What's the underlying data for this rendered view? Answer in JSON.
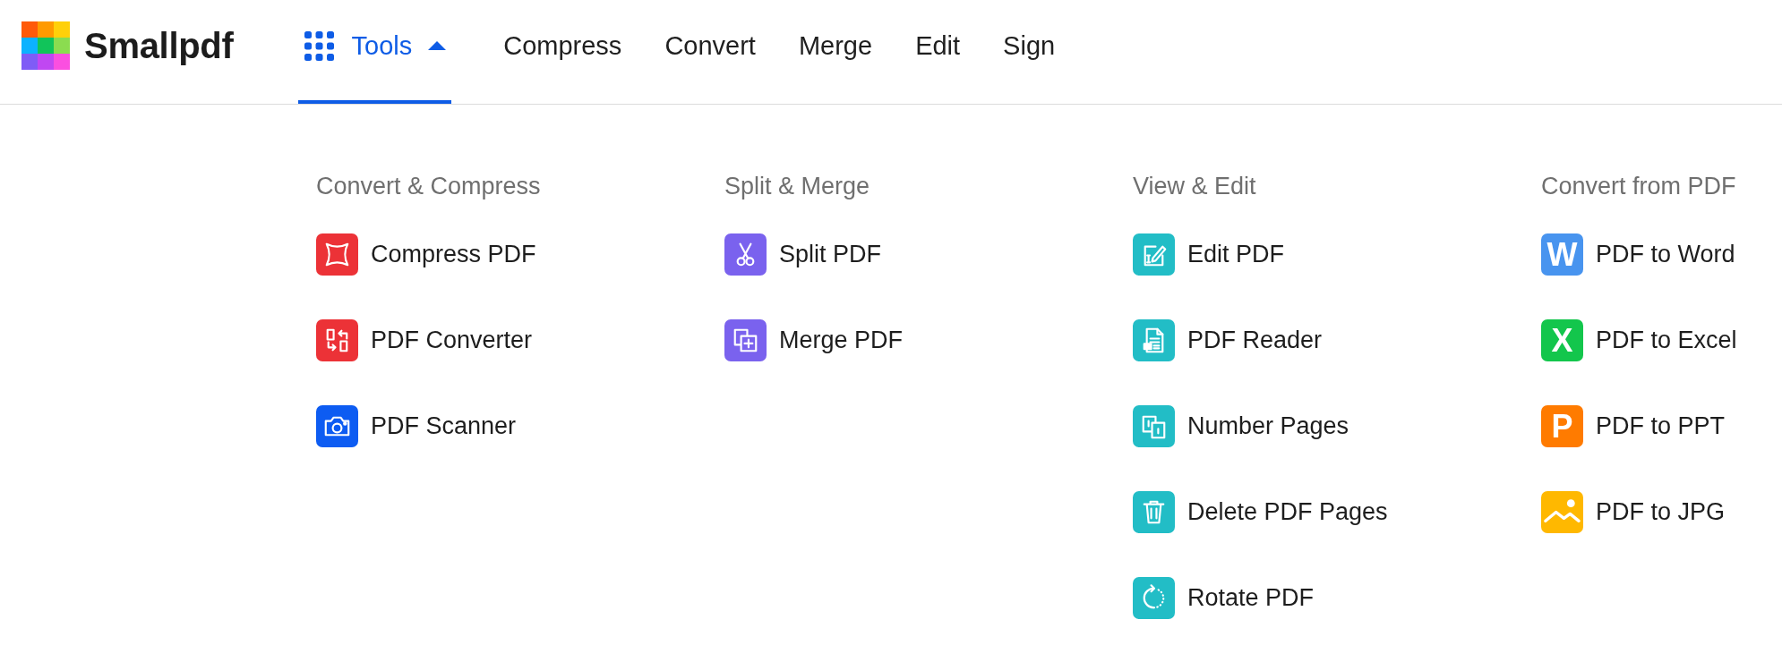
{
  "header": {
    "logo": {
      "name": "Smallpdf"
    },
    "tools_menu": {
      "label": "Tools",
      "expanded": true
    },
    "nav": [
      {
        "label": "Compress"
      },
      {
        "label": "Convert"
      },
      {
        "label": "Merge"
      },
      {
        "label": "Edit"
      },
      {
        "label": "Sign"
      }
    ]
  },
  "menu": {
    "columns": [
      {
        "heading": "Convert & Compress",
        "items": [
          {
            "label": "Compress PDF",
            "kind": "compress",
            "color": "#ec3237"
          },
          {
            "label": "PDF Converter",
            "kind": "convert",
            "color": "#ec3237"
          },
          {
            "label": "PDF Scanner",
            "kind": "camera",
            "color": "#0d5cf2"
          }
        ]
      },
      {
        "heading": "Split & Merge",
        "items": [
          {
            "label": "Split PDF",
            "kind": "scissors",
            "color": "#7a62ee"
          },
          {
            "label": "Merge PDF",
            "kind": "merge",
            "color": "#7a62ee"
          }
        ]
      },
      {
        "heading": "View & Edit",
        "items": [
          {
            "label": "Edit PDF",
            "kind": "edit",
            "color": "#22bdc6"
          },
          {
            "label": "PDF Reader",
            "kind": "reader",
            "color": "#22bdc6"
          },
          {
            "label": "Number Pages",
            "kind": "number",
            "color": "#22bdc6"
          },
          {
            "label": "Delete PDF Pages",
            "kind": "trash",
            "color": "#22bdc6"
          },
          {
            "label": "Rotate PDF",
            "kind": "rotate",
            "color": "#22bdc6"
          }
        ]
      },
      {
        "heading": "Convert from PDF",
        "items": [
          {
            "label": "PDF to Word",
            "kind": "letter",
            "glyph": "W",
            "color": "#4894ef"
          },
          {
            "label": "PDF to Excel",
            "kind": "letter",
            "glyph": "X",
            "color": "#13c64c"
          },
          {
            "label": "PDF to PPT",
            "kind": "letter",
            "glyph": "P",
            "color": "#ff7b00"
          },
          {
            "label": "PDF to JPG",
            "kind": "image",
            "color": "#ffb800"
          }
        ]
      }
    ]
  }
}
